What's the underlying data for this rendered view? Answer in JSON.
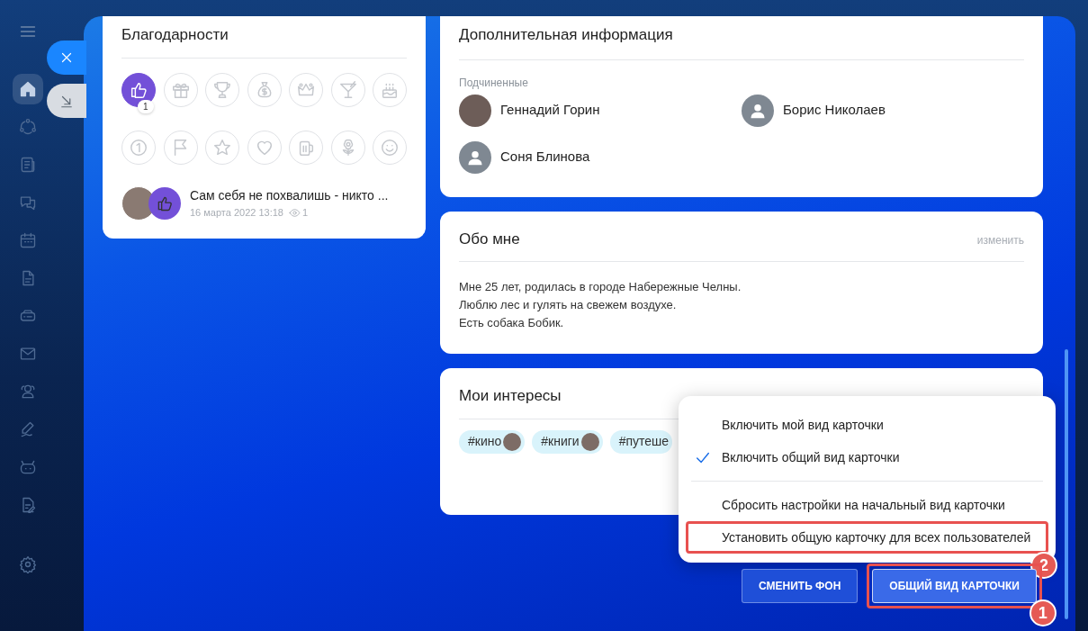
{
  "sidebar": {
    "items": [
      {
        "kind": "home",
        "selected": true
      },
      {
        "kind": "flow",
        "selected": false
      },
      {
        "kind": "news",
        "selected": false
      },
      {
        "kind": "chat",
        "selected": false
      },
      {
        "kind": "calendar",
        "selected": false
      },
      {
        "kind": "document",
        "selected": false
      },
      {
        "kind": "drive",
        "selected": false
      },
      {
        "kind": "mail",
        "selected": false
      },
      {
        "kind": "people",
        "selected": false
      },
      {
        "kind": "sign",
        "selected": false
      },
      {
        "kind": "bot",
        "selected": false
      },
      {
        "kind": "editdoc",
        "selected": false
      },
      {
        "kind": "gear",
        "selected": false
      }
    ]
  },
  "thanks": {
    "title": "Благодарности",
    "badges": [
      {
        "kind": "like",
        "selected": true,
        "count": "1"
      },
      {
        "kind": "gift",
        "selected": false
      },
      {
        "kind": "trophy",
        "selected": false
      },
      {
        "kind": "money",
        "selected": false
      },
      {
        "kind": "crown",
        "selected": false
      },
      {
        "kind": "cocktail",
        "selected": false
      },
      {
        "kind": "cake",
        "selected": false
      },
      {
        "kind": "one",
        "selected": false
      },
      {
        "kind": "flag",
        "selected": false
      },
      {
        "kind": "star",
        "selected": false
      },
      {
        "kind": "heart",
        "selected": false
      },
      {
        "kind": "beer",
        "selected": false
      },
      {
        "kind": "flower",
        "selected": false
      },
      {
        "kind": "smile",
        "selected": false
      }
    ],
    "feed": [
      {
        "text": "Сам себя не похвалишь - никто ...",
        "date": "16 марта 2022 13:18",
        "views": "1"
      }
    ]
  },
  "additional": {
    "title": "Дополнительная информация",
    "label": "Подчиненные",
    "people": [
      {
        "name": "Геннадий Горин",
        "photo": true
      },
      {
        "name": "Борис Николаев",
        "photo": false
      },
      {
        "name": "Соня Блинова",
        "photo": false
      }
    ]
  },
  "about": {
    "title": "Обо мне",
    "edit_link": "изменить",
    "lines": [
      "Мне 25 лет, родилась в городе Набережные Челны.",
      "Люблю лес и гулять на свежем воздухе.",
      "Есть собака Бобик."
    ]
  },
  "interests": {
    "title": "Мои интересы",
    "tags": [
      {
        "text": "#кино",
        "avatar": true
      },
      {
        "text": "#книги",
        "avatar": true
      },
      {
        "text": "#путеше",
        "avatar": false
      }
    ]
  },
  "menu": {
    "items": [
      {
        "kind": "option",
        "label": "Включить мой вид карточки",
        "checked": false
      },
      {
        "kind": "option",
        "label": "Включить общий вид карточки",
        "checked": true
      },
      {
        "kind": "divider"
      },
      {
        "kind": "option",
        "label": "Сбросить настройки на начальный вид карточки",
        "checked": false
      },
      {
        "kind": "option",
        "label": "Установить общую карточку для всех пользователей",
        "checked": false,
        "callout": "2"
      }
    ]
  },
  "buttons": [
    {
      "label": "СМЕНИТЬ ФОН",
      "active": false
    },
    {
      "label": "ОБЩИЙ ВИД КАРТОЧКИ",
      "active": true,
      "callout": "1"
    }
  ]
}
